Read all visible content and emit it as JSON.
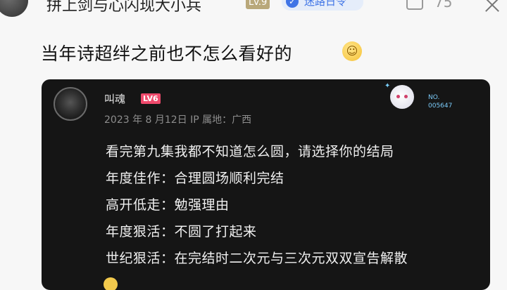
{
  "header": {
    "username": "拼上剑与心闪现大小兵",
    "level": "Lv.9",
    "verified_label": "迷路日令",
    "comment_count": "75"
  },
  "post": {
    "text": "当年诗超绊之前也不怎么看好的"
  },
  "quoted_card": {
    "name": "叫魂",
    "level": "LV6",
    "meta": "2023 年 8 月12日  IP 属地：广西",
    "deco_no_label": "NO.",
    "deco_no_value": "005647",
    "lines": [
      "看完第九集我都不知道怎么圆，请选择你的结局",
      "年度佳作：合理圆场顺利完结",
      "高开低走：勉强理由",
      "年度狠活：不圆了打起来",
      "世纪狠活：在完结时二次元与三次元双双宣告解散"
    ]
  },
  "icons": {
    "comment": "comment-icon",
    "more": "close-icon",
    "verified": "verified-icon",
    "emoji": "smile-emoji"
  },
  "colors": {
    "card_bg": "#151515",
    "level_badge": "#f04a6c",
    "verified_blue": "#3f74e6"
  }
}
